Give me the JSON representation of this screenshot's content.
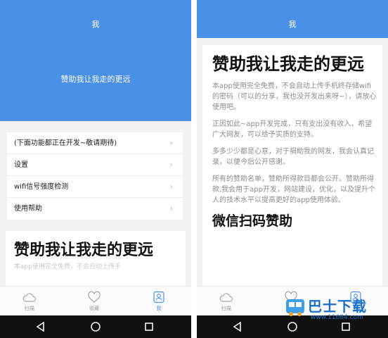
{
  "colors": {
    "brand": "#4a90e6",
    "card": "#ffffff",
    "background": "#f2f2f2",
    "navbar": "#111111",
    "watermark": "#1a6fc9"
  },
  "left": {
    "header_title": "我",
    "sponsor_link": "赞助我让我走的更远",
    "menu": [
      {
        "label": "(下面功能都正在开发~敬请期待)",
        "icon": "chevron-right-icon"
      },
      {
        "label": "设置",
        "icon": "chevron-right-icon"
      },
      {
        "label": "wifi信号强度检测",
        "icon": "chevron-right-icon"
      },
      {
        "label": "使用帮助",
        "icon": "chevron-right-icon"
      }
    ],
    "card": {
      "title": "赞助我让我走的更远",
      "preview_text": "本app使用完全免费，不会自动上传手"
    }
  },
  "tabs": [
    {
      "label": "扫描",
      "icon": "cloud-icon",
      "active": false
    },
    {
      "label": "收藏",
      "icon": "heart-icon",
      "active": false
    },
    {
      "label": "我",
      "icon": "person-icon",
      "active": true
    }
  ],
  "right": {
    "header_title": "我",
    "card": {
      "title": "赞助我让我走的更远",
      "paragraphs": [
        "本app使用完全免费，不会自动上传手机终存储wifi的密码（可以的分享，我也没开发出来呀~），请放心使用吧。",
        "正因如此~app开发完成，只有支出没有收入，希望广大网友，可以给予实质的支持。",
        "多多少少都是心意，对于捐助我的网友，我会认真记录，以便今后公开感谢。",
        "所有的赞助名单，赞助所得款目都会公开。赞助所得款,我会用于app开发，网站建设，优化，以及提升个人的技术水平以提高更好的app使用体验。"
      ],
      "wechat_heading": "微信扫码赞助"
    }
  },
  "system_nav": {
    "back": "back-triangle-icon",
    "home": "home-circle-icon",
    "recents": "recents-square-icon"
  },
  "watermark": {
    "name": "巴士下载",
    "url": "www.11684.com"
  }
}
